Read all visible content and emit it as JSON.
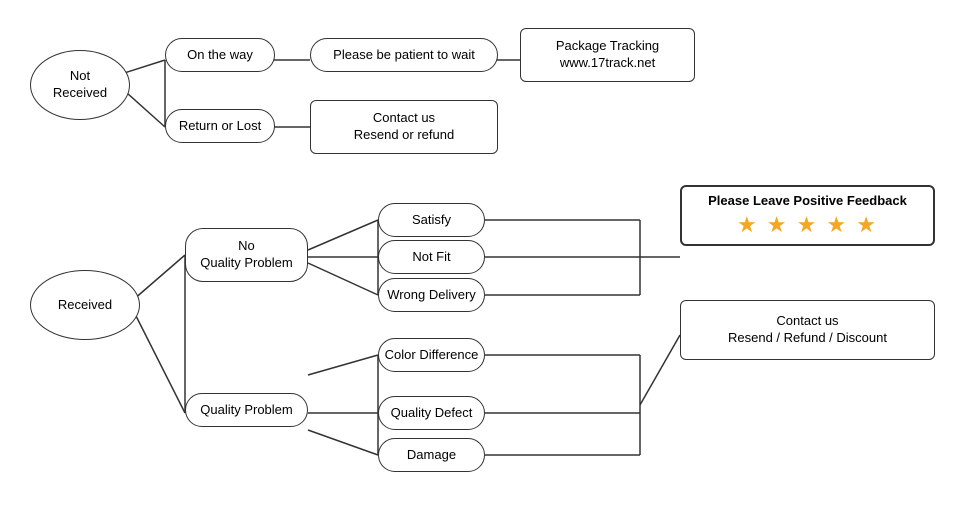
{
  "nodes": {
    "not_received": {
      "label": "Not\nReceived"
    },
    "on_the_way": {
      "label": "On the way"
    },
    "please_wait": {
      "label": "Please be patient to wait"
    },
    "package_tracking": {
      "label": "Package Tracking\nwww.17track.net"
    },
    "return_lost": {
      "label": "Return or Lost"
    },
    "contact_resend_refund": {
      "label": "Contact us\nResend or refund"
    },
    "received": {
      "label": "Received"
    },
    "no_quality_problem": {
      "label": "No\nQuality Problem"
    },
    "satisfy": {
      "label": "Satisfy"
    },
    "not_fit": {
      "label": "Not Fit"
    },
    "wrong_delivery": {
      "label": "Wrong Delivery"
    },
    "quality_problem": {
      "label": "Quality Problem"
    },
    "color_difference": {
      "label": "Color Difference"
    },
    "quality_defect": {
      "label": "Quality Defect"
    },
    "damage": {
      "label": "Damage"
    },
    "feedback_title": {
      "label": "Please Leave Positive Feedback"
    },
    "contact_resend_refund_discount": {
      "label": "Contact us\nResend / Refund / Discount"
    }
  },
  "stars": "★ ★ ★ ★ ★"
}
